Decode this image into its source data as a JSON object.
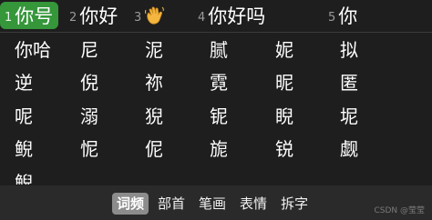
{
  "candidates": [
    {
      "num": "1",
      "text": "你号",
      "selected": true
    },
    {
      "num": "2",
      "text": "你好",
      "selected": false
    },
    {
      "num": "3",
      "text": "",
      "icon": "waving-hand-emoji",
      "selected": false
    },
    {
      "num": "4",
      "text": "你好吗",
      "selected": false
    },
    {
      "num": "5",
      "text": "你",
      "selected": false
    }
  ],
  "grid_rows": [
    [
      "你哈",
      "尼",
      "泥",
      "腻",
      "妮",
      "拟"
    ],
    [
      "逆",
      "倪",
      "祢",
      "霓",
      "昵",
      "匿"
    ],
    [
      "呢",
      "溺",
      "猊",
      "铌",
      "睨",
      "坭"
    ],
    [
      "鲵",
      "怩",
      "伲",
      "旎",
      "锐",
      "觑"
    ],
    [
      "鲵"
    ]
  ],
  "tabs": [
    {
      "label": "词频",
      "active": true
    },
    {
      "label": "部首",
      "active": false
    },
    {
      "label": "笔画",
      "active": false
    },
    {
      "label": "表情",
      "active": false
    },
    {
      "label": "拆字",
      "active": false
    }
  ],
  "watermark": "CSDN @莹莹",
  "colors": {
    "background": "#1e1e1e",
    "selected": "#35963a",
    "tab_active": "#8c8c8c"
  }
}
